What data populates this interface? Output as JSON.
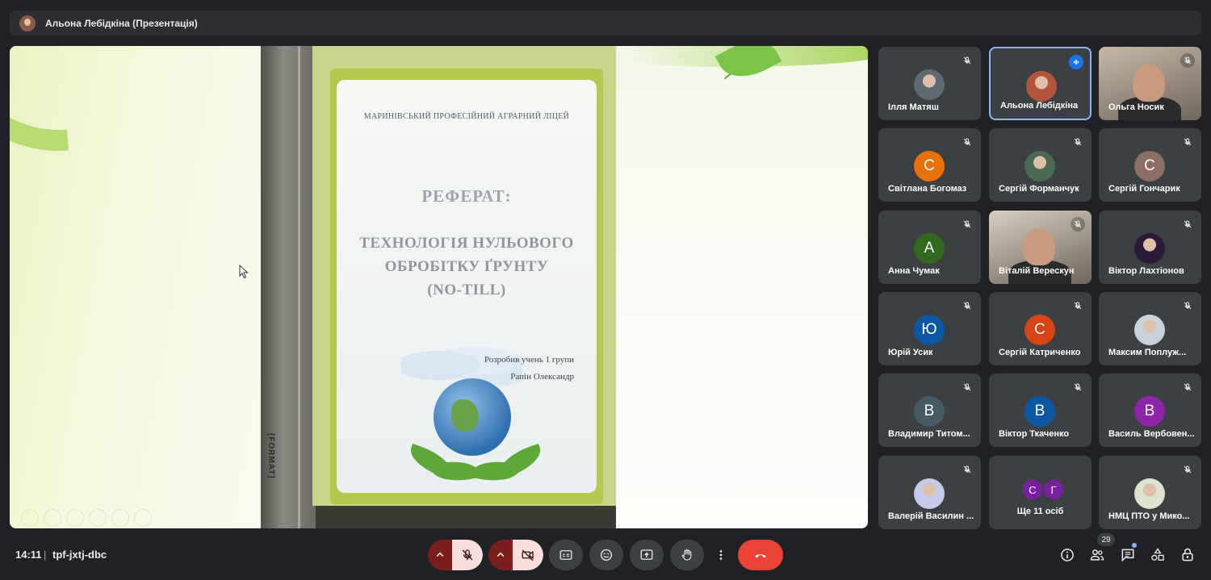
{
  "presenter_bar": {
    "title": "Альона Лебідкіна (Презентація)"
  },
  "slide": {
    "school": "МАРИНІВСЬКИЙ ПРОФЕСІЙНИЙ АГРАРНИЙ ЛІЦЕЙ",
    "heading": "РЕФЕРАТ:",
    "topic_line1": "ТЕХНОЛОГІЯ НУЛЬОВОГО",
    "topic_line2": "ОБРОБІТКУ ҐРУНТУ",
    "topic_line3": "(NO-TILL)",
    "author_line1": "Розробив учень 1 групи",
    "author_line2": "Рапін Олександр",
    "spine_label": "[FORMAT]"
  },
  "participants": [
    {
      "name": "Ілля Матяш",
      "muted": true,
      "avatar_type": "photo",
      "color": "#5f6b73"
    },
    {
      "name": "Альона Лебідкіна",
      "muted": false,
      "speaking": true,
      "avatar_type": "photo",
      "color": "#b5543c"
    },
    {
      "name": "Ольга Носик",
      "muted": true,
      "avatar_type": "video",
      "color": "#c9b8a6"
    },
    {
      "name": "Світлана Богомаз",
      "muted": true,
      "avatar_type": "letter",
      "letter": "С",
      "color": "#e8710a"
    },
    {
      "name": "Сергій Форманчук",
      "muted": true,
      "avatar_type": "photo",
      "color": "#4a6a52"
    },
    {
      "name": "Сергій Гончарик",
      "muted": true,
      "avatar_type": "letter",
      "letter": "С",
      "color": "#8d6e63"
    },
    {
      "name": "Анна Чумак",
      "muted": true,
      "avatar_type": "letter",
      "letter": "А",
      "color": "#33691e"
    },
    {
      "name": "Віталій Верескун",
      "muted": true,
      "avatar_type": "video",
      "color": "#d8cfc0"
    },
    {
      "name": "Віктор Лахтіонов",
      "muted": true,
      "avatar_type": "photo",
      "color": "#2a1a3a"
    },
    {
      "name": "Юрій Усик",
      "muted": true,
      "avatar_type": "letter",
      "letter": "Ю",
      "color": "#0b57a4"
    },
    {
      "name": "Сергій Катриченко",
      "muted": true,
      "avatar_type": "letter",
      "letter": "С",
      "color": "#d84315"
    },
    {
      "name": "Максим Поплуж...",
      "muted": true,
      "avatar_type": "photo",
      "color": "#c8d2dc"
    },
    {
      "name": "Владимир Титом...",
      "muted": true,
      "avatar_type": "letter",
      "letter": "В",
      "color": "#455a64"
    },
    {
      "name": "Віктор Ткаченко",
      "muted": true,
      "avatar_type": "letter",
      "letter": "В",
      "color": "#0b57a4"
    },
    {
      "name": "Василь Вербовен...",
      "muted": true,
      "avatar_type": "letter",
      "letter": "В",
      "color": "#8e24aa"
    },
    {
      "name": "Валерій Василин ...",
      "muted": true,
      "avatar_type": "photo",
      "color": "#c5cae9"
    },
    {
      "name": "Ще 11 осіб",
      "muted": false,
      "avatar_type": "more",
      "letters": [
        "С",
        "Г"
      ],
      "color": "#7b1fa2"
    },
    {
      "name": "НМЦ ПТО у Мико...",
      "muted": true,
      "avatar_type": "photo",
      "color": "#dce4d0"
    }
  ],
  "bottom_bar": {
    "time": "14:11",
    "separator": "|",
    "meeting_code": "tpf-jxtj-dbc",
    "participant_count": "29"
  },
  "icons": {
    "mic_off": "mic-off-icon",
    "camera_off": "camera-off-icon",
    "captions": "captions-icon",
    "emoji": "emoji-icon",
    "present": "present-icon",
    "raise_hand": "raise-hand-icon",
    "more": "more-vert-icon",
    "hangup": "hangup-icon",
    "info": "info-icon",
    "people": "people-icon",
    "chat": "chat-icon",
    "activities": "activities-icon",
    "host_controls": "host-controls-icon"
  }
}
